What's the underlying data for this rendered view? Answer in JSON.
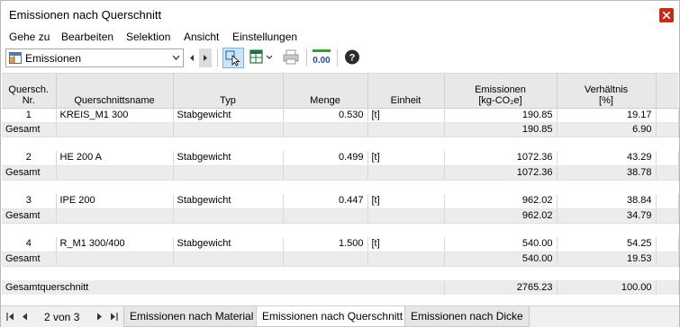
{
  "window": {
    "title": "Emissionen nach Querschnitt"
  },
  "menu": [
    "Gehe zu",
    "Bearbeiten",
    "Selektion",
    "Ansicht",
    "Einstellungen"
  ],
  "toolbar": {
    "combo_value": "Emissionen"
  },
  "table": {
    "headers": {
      "nr": [
        "Quersch.",
        "Nr."
      ],
      "name": "Querschnittsname",
      "typ": "Typ",
      "menge": "Menge",
      "einheit": "Einheit",
      "emissionen": [
        "Emissionen",
        "[kg-CO₂e]"
      ],
      "verhaeltnis": [
        "Verhältnis",
        "[%]"
      ]
    },
    "groups": [
      {
        "nr": "1",
        "name": "KREIS_M1 300",
        "typ": "Stabgewicht",
        "menge": "0.530",
        "einheit": "[t]",
        "emissionen": "190.85",
        "verhaeltnis": "19.17",
        "total_label": "Gesamt",
        "total_emissionen": "190.85",
        "total_verhaeltnis": "6.90"
      },
      {
        "nr": "2",
        "name": "HE 200 A",
        "typ": "Stabgewicht",
        "menge": "0.499",
        "einheit": "[t]",
        "emissionen": "1072.36",
        "verhaeltnis": "43.29",
        "total_label": "Gesamt",
        "total_emissionen": "1072.36",
        "total_verhaeltnis": "38.78"
      },
      {
        "nr": "3",
        "name": "IPE 200",
        "typ": "Stabgewicht",
        "menge": "0.447",
        "einheit": "[t]",
        "emissionen": "962.02",
        "verhaeltnis": "38.84",
        "total_label": "Gesamt",
        "total_emissionen": "962.02",
        "total_verhaeltnis": "34.79"
      },
      {
        "nr": "4",
        "name": "R_M1 300/400",
        "typ": "Stabgewicht",
        "menge": "1.500",
        "einheit": "[t]",
        "emissionen": "540.00",
        "verhaeltnis": "54.25",
        "total_label": "Gesamt",
        "total_emissionen": "540.00",
        "total_verhaeltnis": "19.53"
      }
    ],
    "grand_total": {
      "label": "Gesamtquerschnitt",
      "emissionen": "2765.23",
      "verhaeltnis": "100.00"
    }
  },
  "status": {
    "page_info": "2 von 3",
    "tabs": [
      "Emissionen nach Material",
      "Emissionen nach Querschnitt",
      "Emissionen nach Dicke"
    ],
    "active_tab": 1
  }
}
